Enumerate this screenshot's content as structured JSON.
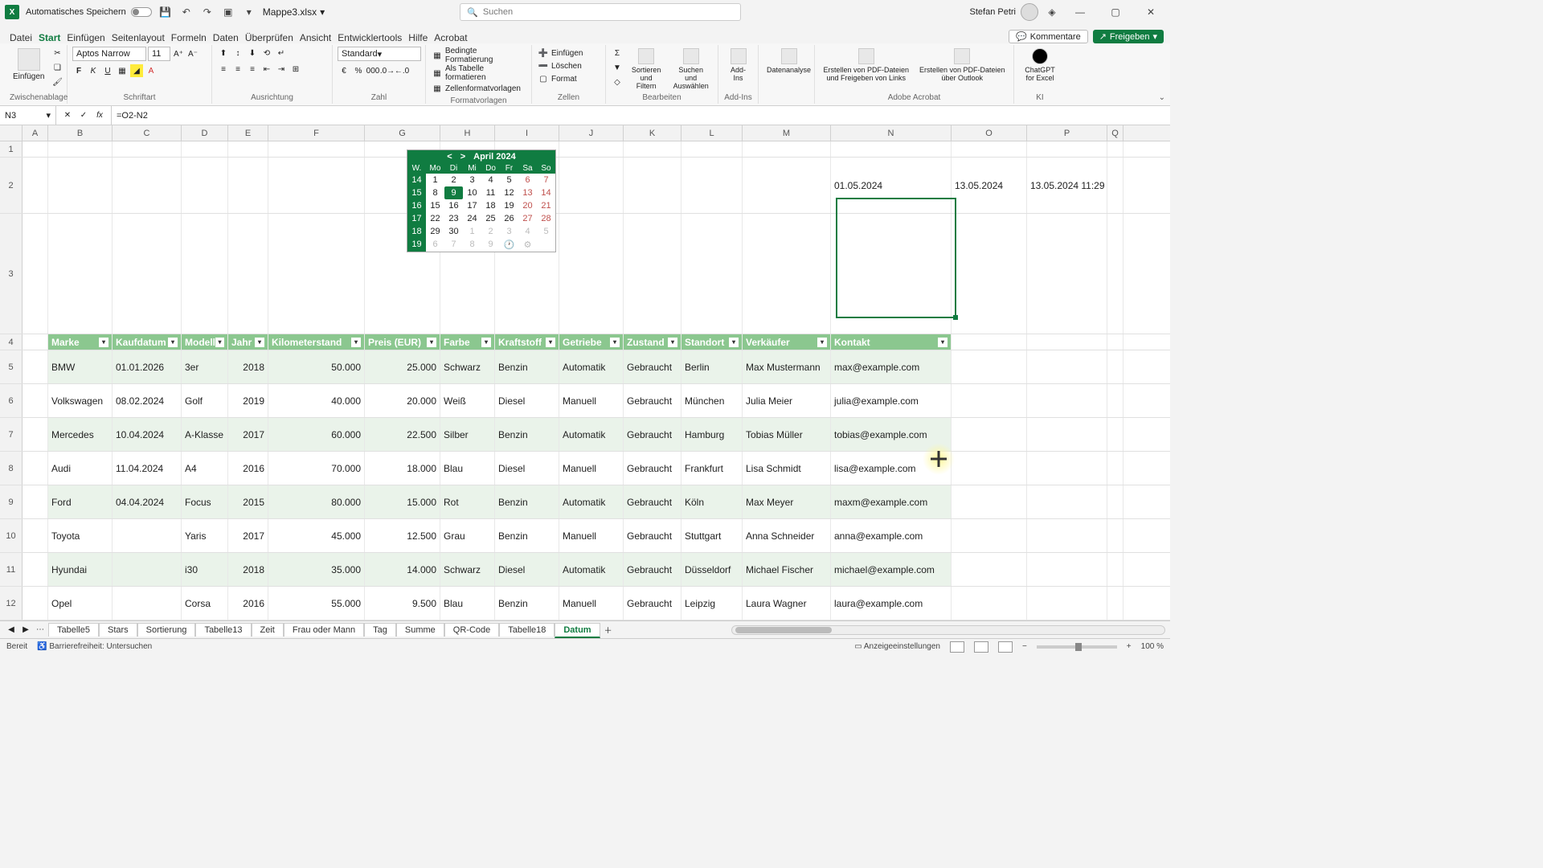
{
  "title": {
    "autosave": "Automatisches Speichern",
    "filename": "Mappe3.xlsx",
    "search": "Suchen",
    "user": "Stefan Petri"
  },
  "menu": {
    "tabs": [
      "Datei",
      "Start",
      "Einfügen",
      "Seitenlayout",
      "Formeln",
      "Daten",
      "Überprüfen",
      "Ansicht",
      "Entwicklertools",
      "Hilfe",
      "Acrobat"
    ],
    "activeIndex": 1,
    "comments": "Kommentare",
    "share": "Freigeben"
  },
  "ribbon": {
    "clipboard": {
      "paste": "Einfügen",
      "label": "Zwischenablage"
    },
    "font": {
      "name": "Aptos Narrow",
      "size": "11",
      "label": "Schriftart"
    },
    "align": {
      "label": "Ausrichtung"
    },
    "number": {
      "format": "Standard",
      "label": "Zahl"
    },
    "styles": {
      "a": "Bedingte Formatierung",
      "b": "Als Tabelle formatieren",
      "c": "Zellenformatvorlagen",
      "label": "Formatvorlagen"
    },
    "cells": {
      "a": "Einfügen",
      "b": "Löschen",
      "c": "Format",
      "label": "Zellen"
    },
    "edit": {
      "a": "Sortieren und Filtern",
      "b": "Suchen und Auswählen",
      "label": "Bearbeiten"
    },
    "addins": {
      "a": "Add-Ins",
      "label": "Add-Ins"
    },
    "data": {
      "a": "Datenanalyse"
    },
    "adobe": {
      "a": "Erstellen von PDF-Dateien und Freigeben von Links",
      "b": "Erstellen von PDF-Dateien über Outlook",
      "label": "Adobe Acrobat"
    },
    "gpt": {
      "a": "ChatGPT for Excel",
      "label": "KI"
    }
  },
  "formula": {
    "name": "N3",
    "fx": "=O2-N2"
  },
  "columns": [
    "A",
    "B",
    "C",
    "D",
    "E",
    "F",
    "G",
    "H",
    "I",
    "J",
    "K",
    "L",
    "M",
    "N",
    "O",
    "P",
    "Q"
  ],
  "rowhdrs": [
    "1",
    "2",
    "3",
    "4",
    "5",
    "6",
    "7",
    "8",
    "9",
    "10",
    "11",
    "12"
  ],
  "r2": {
    "n": "01.05.2024",
    "o": "13.05.2024",
    "p": "13.05.2024 11:29"
  },
  "cal": {
    "month": "April 2024",
    "days": [
      "W.",
      "Mo",
      "Di",
      "Mi",
      "Do",
      "Fr",
      "Sa",
      "So"
    ],
    "rows": [
      [
        "14",
        "1",
        "2",
        "3",
        "4",
        "5",
        "6",
        "7"
      ],
      [
        "15",
        "8",
        "9",
        "10",
        "11",
        "12",
        "13",
        "14"
      ],
      [
        "16",
        "15",
        "16",
        "17",
        "18",
        "19",
        "20",
        "21"
      ],
      [
        "17",
        "22",
        "23",
        "24",
        "25",
        "26",
        "27",
        "28"
      ],
      [
        "18",
        "29",
        "30",
        "1",
        "2",
        "3",
        "4",
        "5"
      ],
      [
        "19",
        "6",
        "7",
        "8",
        "9",
        "🕐",
        "⚙",
        ""
      ]
    ]
  },
  "thead": [
    "Marke",
    "Kaufdatum",
    "Modell",
    "Jahr",
    "Kilometerstand",
    "Preis (EUR)",
    "Farbe",
    "Kraftstoff",
    "Getriebe",
    "Zustand",
    "Standort",
    "Verkäufer",
    "Kontakt"
  ],
  "tdata": [
    [
      "BMW",
      "01.01.2026",
      "3er",
      "2018",
      "50.000",
      "25.000",
      "Schwarz",
      "Benzin",
      "Automatik",
      "Gebraucht",
      "Berlin",
      "Max Mustermann",
      "max@example.com"
    ],
    [
      "Volkswagen",
      "08.02.2024",
      "Golf",
      "2019",
      "40.000",
      "20.000",
      "Weiß",
      "Diesel",
      "Manuell",
      "Gebraucht",
      "München",
      "Julia Meier",
      "julia@example.com"
    ],
    [
      "Mercedes",
      "10.04.2024",
      "A-Klasse",
      "2017",
      "60.000",
      "22.500",
      "Silber",
      "Benzin",
      "Automatik",
      "Gebraucht",
      "Hamburg",
      "Tobias Müller",
      "tobias@example.com"
    ],
    [
      "Audi",
      "11.04.2024",
      "A4",
      "2016",
      "70.000",
      "18.000",
      "Blau",
      "Diesel",
      "Manuell",
      "Gebraucht",
      "Frankfurt",
      "Lisa Schmidt",
      "lisa@example.com"
    ],
    [
      "Ford",
      "04.04.2024",
      "Focus",
      "2015",
      "80.000",
      "15.000",
      "Rot",
      "Benzin",
      "Automatik",
      "Gebraucht",
      "Köln",
      "Max Meyer",
      "maxm@example.com"
    ],
    [
      "Toyota",
      "",
      "Yaris",
      "2017",
      "45.000",
      "12.500",
      "Grau",
      "Benzin",
      "Manuell",
      "Gebraucht",
      "Stuttgart",
      "Anna Schneider",
      "anna@example.com"
    ],
    [
      "Hyundai",
      "",
      "i30",
      "2018",
      "35.000",
      "14.000",
      "Schwarz",
      "Diesel",
      "Automatik",
      "Gebraucht",
      "Düsseldorf",
      "Michael Fischer",
      "michael@example.com"
    ],
    [
      "Opel",
      "",
      "Corsa",
      "2016",
      "55.000",
      "9.500",
      "Blau",
      "Benzin",
      "Manuell",
      "Gebraucht",
      "Leipzig",
      "Laura Wagner",
      "laura@example.com"
    ]
  ],
  "sheets": [
    "Tabelle5",
    "Stars",
    "Sortierung",
    "Tabelle13",
    "Zeit",
    "Frau oder Mann",
    "Tag",
    "Summe",
    "QR-Code",
    "Tabelle18",
    "Datum"
  ],
  "activeSheet": 10,
  "status": {
    "ready": "Bereit",
    "acc": "Barrierefreiheit: Untersuchen",
    "disp": "Anzeigeeinstellungen",
    "zoom": "100 %"
  }
}
